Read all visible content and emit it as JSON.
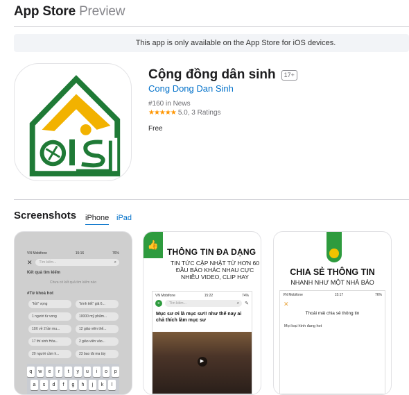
{
  "header": {
    "brand": "App Store",
    "sub": "Preview"
  },
  "banner": {
    "text": "This app is only available on the App Store for iOS devices."
  },
  "app": {
    "title": "Cộng đồng dân sinh",
    "age_rating": "17+",
    "developer": "Cong Dong Dan Sinh",
    "rank": "#160 in News",
    "stars": "★★★★★",
    "rating": "5.0, 3 Ratings",
    "price": "Free",
    "icon_colors": {
      "green": "#1f7a36",
      "yellow": "#f2b200"
    }
  },
  "screenshots": {
    "title": "Screenshots",
    "tabs": [
      "iPhone",
      "iPad"
    ],
    "shot1": {
      "carrier": "VN Mobifone",
      "time": "15:16",
      "battery": "76%",
      "placeholder": "Tìm kiếm...",
      "results_label": "Kết quả tìm kiếm",
      "empty": "Chưa có kết quả tìm kiếm nào",
      "hot_label": "#Từ khoá hot",
      "chips": [
        "\"hồi\" vọng",
        "\"trinh tiết\" giả 6...",
        "1 người từ vong",
        "10000 mỹ phẩm...",
        "10X về 2 lần mu...",
        "12 giáo viên thể...",
        "17 thí sinh Hòa...",
        "2 giáo viên vào...",
        "20 người cầm h...",
        "23 bao tải ma túy"
      ],
      "keys_row1": [
        "q",
        "w",
        "e",
        "r",
        "t",
        "y",
        "u",
        "i",
        "o",
        "p"
      ],
      "keys_row2": [
        "a",
        "s",
        "d",
        "f",
        "g",
        "h",
        "j",
        "k",
        "l"
      ]
    },
    "shot2": {
      "title": "THÔNG TIN ĐA DẠNG",
      "subtitle": "TIN TỨC CẬP NHẬT TỪ HƠN 60 ĐẦU BÁO KHÁC NHAU CỰC NHIỀU VIDEO, CLIP HAY",
      "carrier": "VN Mobifone",
      "time": "15:22",
      "battery": "74%",
      "placeholder": "Tìm kiếm...",
      "headline": "Mục sư ơi là mục sư!! như thế nay ai chả thích làm mục sư"
    },
    "shot3": {
      "title": "CHIA SẺ THÔNG TIN",
      "subtitle": "NHANH NHƯ MỘT NHÀ BÁO",
      "carrier": "VN Mobifone",
      "time": "15:17",
      "battery": "76%",
      "caption": "Thoải mái chia sẻ thông tin",
      "row": "Mọi loại hình đang hot"
    }
  }
}
